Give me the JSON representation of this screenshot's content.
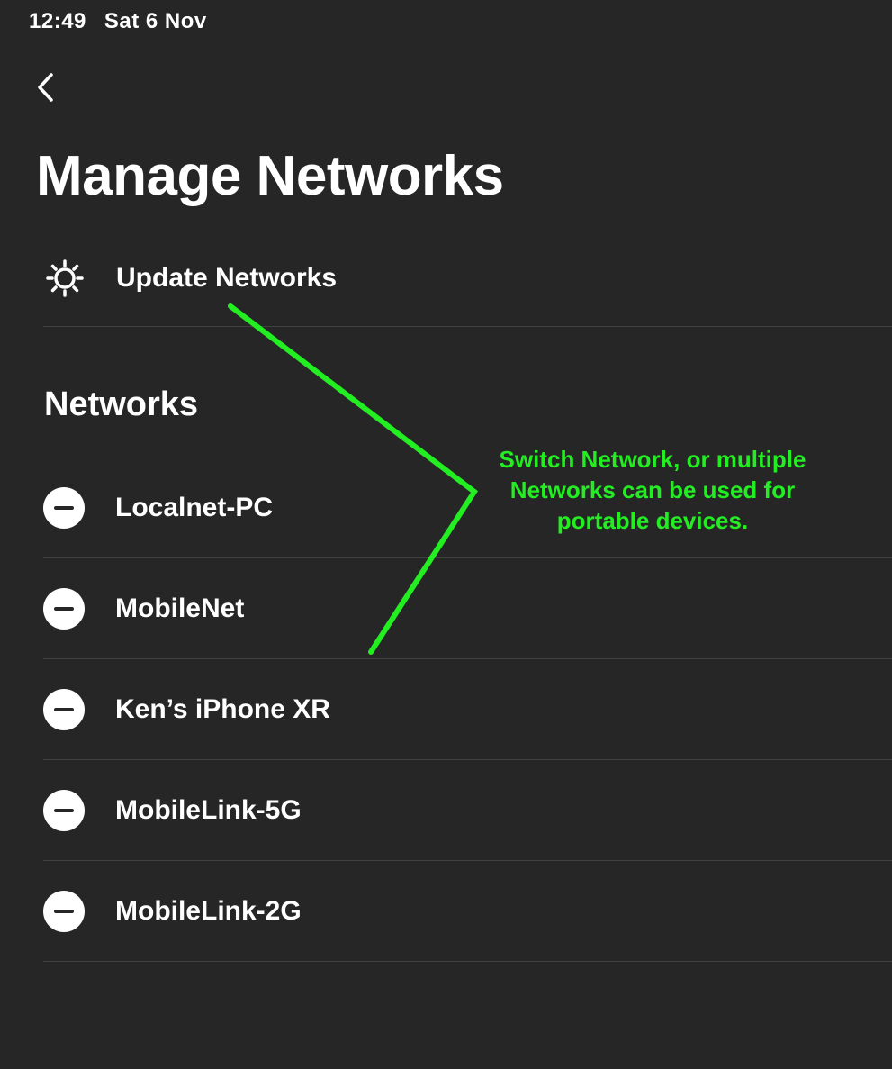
{
  "status_bar": {
    "time": "12:49",
    "date": "Sat 6 Nov"
  },
  "nav": {
    "back_icon": "chevron-left-icon"
  },
  "page_title": "Manage Networks",
  "update_action": {
    "icon": "gear-icon",
    "label": "Update Networks"
  },
  "networks_section": {
    "title": "Networks",
    "items": [
      {
        "label": "Localnet-PC",
        "icon": "remove-icon"
      },
      {
        "label": "MobileNet",
        "icon": "remove-icon"
      },
      {
        "label": "Ken’s iPhone XR",
        "icon": "remove-icon"
      },
      {
        "label": "MobileLink-5G",
        "icon": "remove-icon"
      },
      {
        "label": "MobileLink-2G",
        "icon": "remove-icon"
      }
    ]
  },
  "annotation": {
    "text": "Switch Network, or multiple\nNetworks  can be used for\nportable devices.",
    "color": "#22ee22"
  },
  "colors": {
    "background": "#262626",
    "separator": "#414141",
    "text": "#ffffff"
  }
}
